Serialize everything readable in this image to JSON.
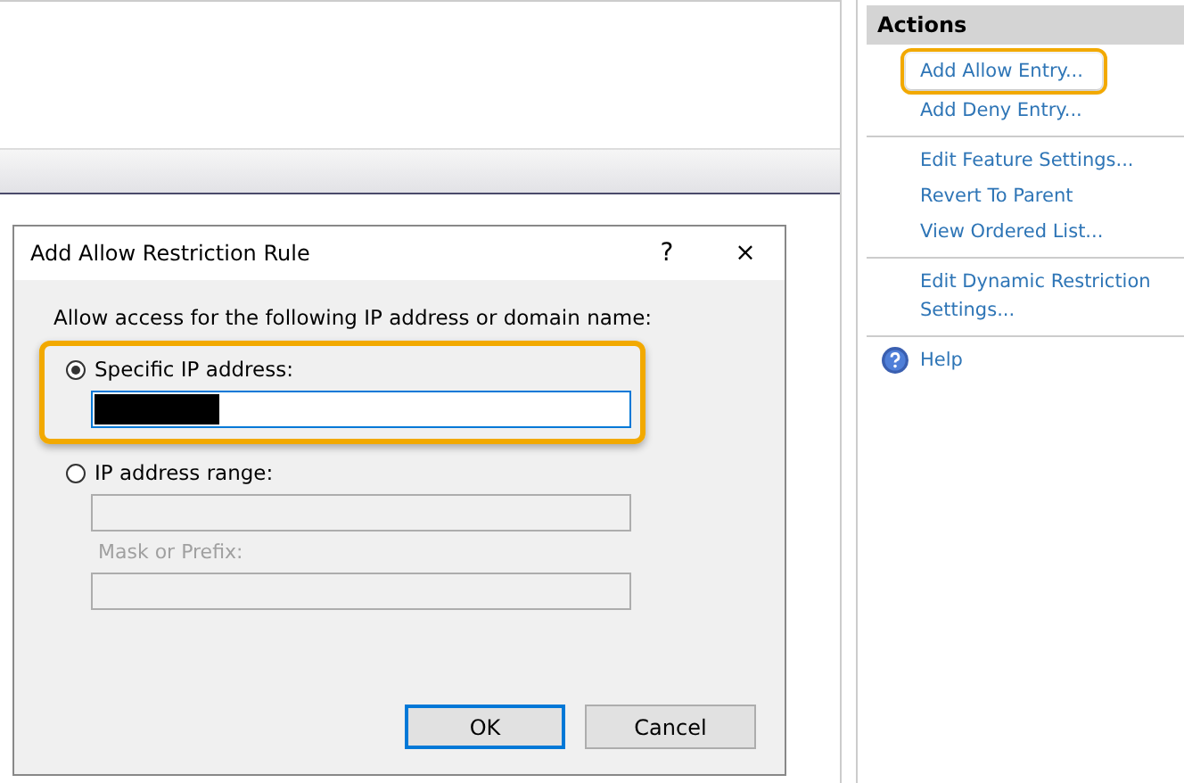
{
  "actions": {
    "title": "Actions",
    "groups": [
      {
        "items": [
          {
            "label": "Add Allow Entry...",
            "highlighted": true
          },
          {
            "label": "Add Deny Entry...",
            "highlighted": false
          }
        ]
      },
      {
        "items": [
          {
            "label": "Edit Feature Settings...",
            "highlighted": false
          },
          {
            "label": "Revert To Parent",
            "highlighted": false
          },
          {
            "label": "View Ordered List...",
            "highlighted": false
          }
        ]
      },
      {
        "items": [
          {
            "label": "Edit Dynamic Restriction Settings...",
            "highlighted": false
          }
        ]
      },
      {
        "items": [
          {
            "label": "Help",
            "highlighted": false,
            "kind": "help"
          }
        ]
      }
    ]
  },
  "dialog": {
    "title": "Add Allow Restriction Rule",
    "help": "?",
    "close": "×",
    "prompt": "Allow access for the following IP address or domain name:",
    "options": [
      {
        "label": "Specific IP address:",
        "selected": true,
        "highlighted": true,
        "fields": [
          {
            "redacted": true,
            "focused": true,
            "disabled": false
          }
        ]
      },
      {
        "label": "IP address range:",
        "selected": false,
        "highlighted": false,
        "fields": [
          {
            "disabled": true
          },
          {
            "label": "Mask or Prefix:",
            "disabled": true
          }
        ]
      }
    ],
    "buttons": [
      {
        "label": "OK",
        "default": true
      },
      {
        "label": "Cancel",
        "default": false
      }
    ]
  }
}
